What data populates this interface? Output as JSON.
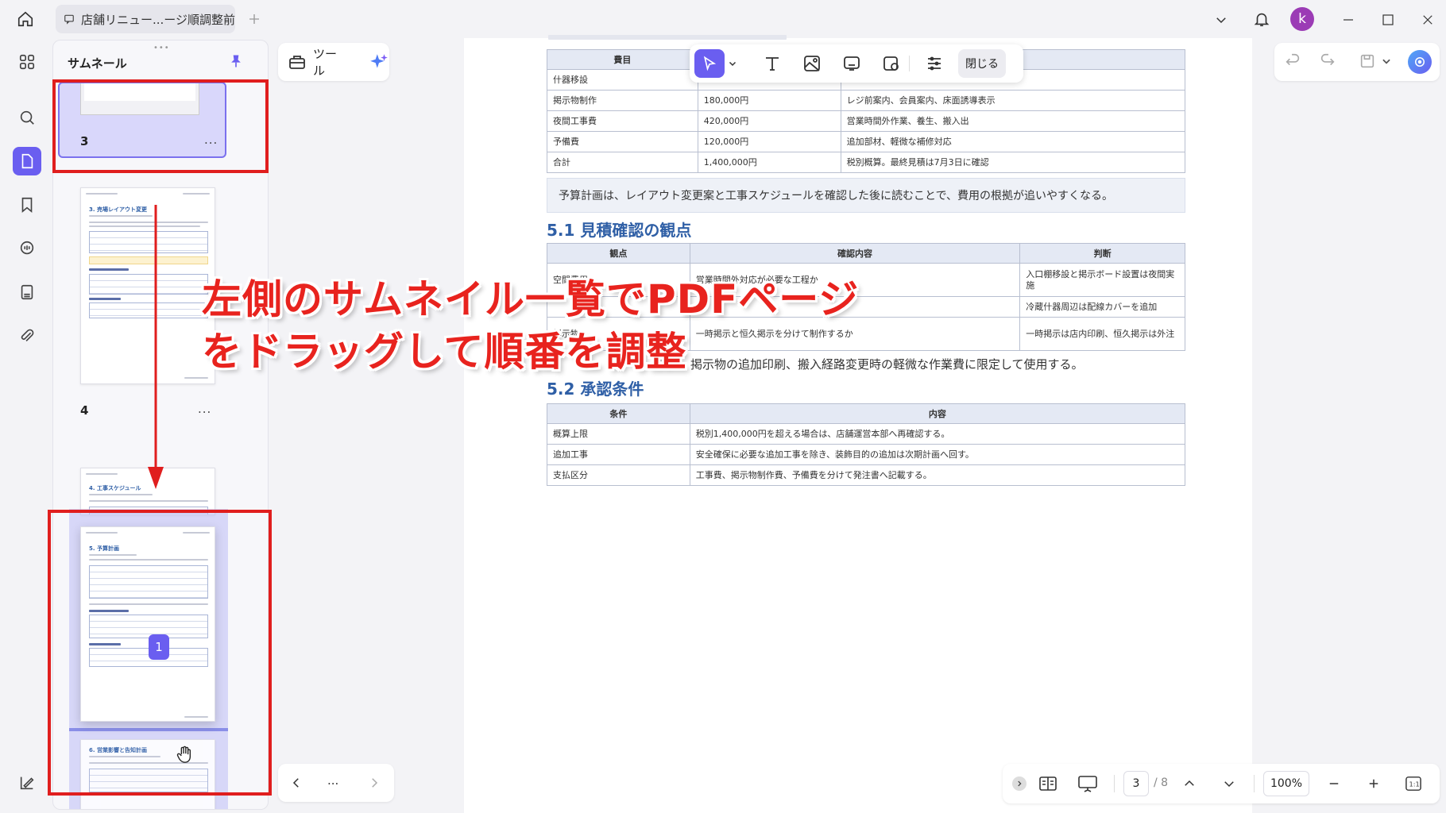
{
  "titlebar": {
    "tab_title": "店舗リニュー...ージ順調整前",
    "avatar_letter": "k"
  },
  "sidebar": {
    "title": "サムネール",
    "pages": [
      {
        "num": "3",
        "more": "..."
      },
      {
        "num": "4",
        "more": "..."
      },
      {
        "drag_badge": "1"
      }
    ],
    "thumb_texts": {
      "p4_heading": "3. 売場レイアウト変更",
      "p5_heading": "4. 工事スケジュール",
      "p6_heading": "5. 予算計画",
      "p7_heading": "6. 営業影響と告知計画"
    }
  },
  "tools": {
    "tool_label": "ツール"
  },
  "edit_toolbar": {
    "close_label": "閉じる"
  },
  "annotation": {
    "line1": "左側のサムネイル一覧でPDFページ",
    "line2": "をドラッグして順番を調整"
  },
  "document": {
    "budget_table": {
      "headers": [
        "費目",
        "",
        ""
      ],
      "rows": [
        [
          "什器移設",
          "",
          ""
        ],
        [
          "掲示物制作",
          "180,000円",
          "レジ前案内、会員案内、床面誘導表示"
        ],
        [
          "夜間工事費",
          "420,000円",
          "営業時間外作業、養生、搬入出"
        ],
        [
          "予備費",
          "120,000円",
          "追加部材、軽微な補修対応"
        ],
        [
          "合計",
          "1,400,000円",
          "税別概算。最終見積は7月3日に確認"
        ]
      ]
    },
    "note": "予算計画は、レイアウト変更案と工事スケジュールを確認した後に読むことで、費用の根拠が追いやすくなる。",
    "section_51": "5.1 見積確認の観点",
    "estimate_table": {
      "headers": [
        "観点",
        "確認内容",
        "判断"
      ],
      "rows": [
        [
          "空間費用",
          "営業時間外対応が必要な工程か",
          "入口棚移設と掲示ボード設置は夜間実施"
        ],
        [
          "",
          "",
          "冷蔵什器周辺は配線カバーを追加"
        ],
        [
          "掲示物",
          "一時掲示と恒久掲示を分けて制作するか",
          "一時掲示は店内印刷、恒久掲示は外注"
        ]
      ]
    },
    "paragraph": "補修、掲示物の追加印刷、搬入経路変更時の軽微な作業費に限定して使用する。",
    "section_52": "5.2 承認条件",
    "approval_table": {
      "headers": [
        "条件",
        "内容"
      ],
      "rows": [
        [
          "概算上限",
          "税別1,400,000円を超える場合は、店舗運営本部へ再確認する。"
        ],
        [
          "追加工事",
          "安全確保に必要な追加工事を除き、装飾目的の追加は次期計画へ回す。"
        ],
        [
          "支払区分",
          "工事費、掲示物制作費、予備費を分けて発注書へ記載する。"
        ]
      ]
    }
  },
  "bottombar": {
    "current_page": "3",
    "total_pages": "/ 8",
    "zoom": "100%"
  },
  "nav": {
    "more": "..."
  },
  "colors": {
    "accent": "#6a5ef0",
    "annotation_red": "#e01e1e",
    "heading_blue": "#2f5fa6"
  }
}
